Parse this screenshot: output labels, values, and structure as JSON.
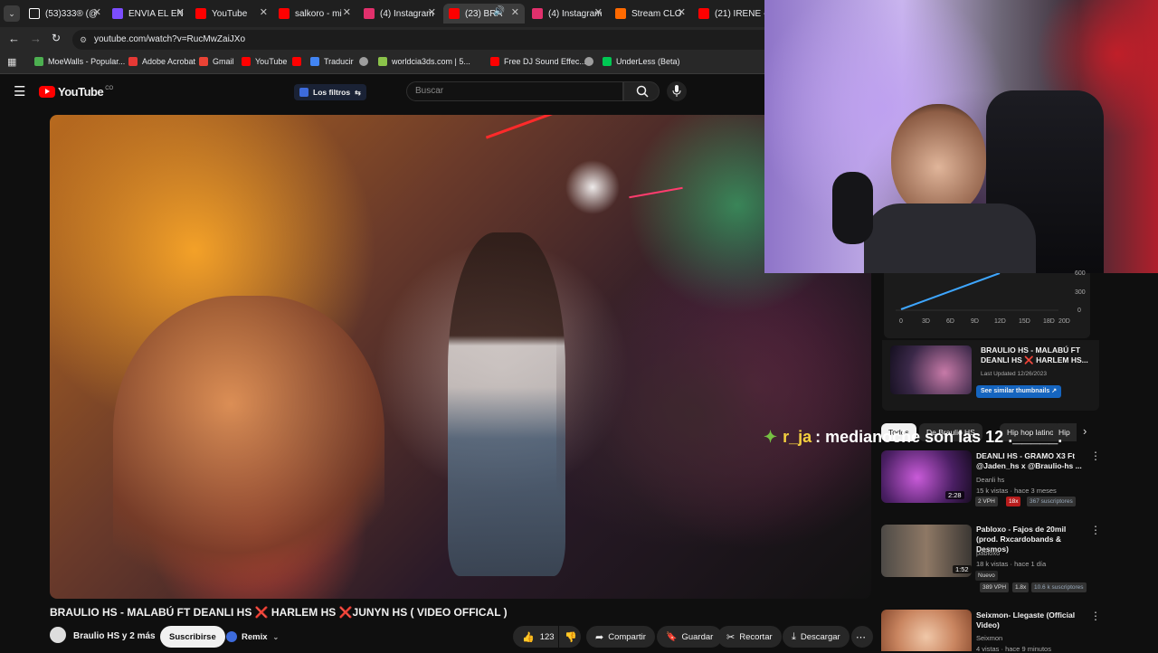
{
  "browser": {
    "tabs": [
      {
        "title": "(53)333® (@",
        "color": "#ffffff"
      },
      {
        "title": "ENVIA EL EN",
        "color": "#7c4dff"
      },
      {
        "title": "YouTube",
        "color": "#ff0000"
      },
      {
        "title": "salkoro - mi",
        "color": "#ff0000"
      },
      {
        "title": "(4) Instagram",
        "color": "#e1306c"
      },
      {
        "title": "(23) BRA",
        "color": "#ff0000"
      },
      {
        "title": "(4) Instagram",
        "color": "#e1306c"
      },
      {
        "title": "Stream CLO",
        "color": "#ff6a00"
      },
      {
        "title": "(21) IRENE -",
        "color": "#ff0000"
      }
    ],
    "tab_close": "✕",
    "url": "youtube.com/watch?v=RucMwZaiJXo",
    "bookmarks": [
      {
        "label": "MoeWalls - Popular...",
        "color": "#4caf50"
      },
      {
        "label": "Adobe Acrobat",
        "color": "#e53935"
      },
      {
        "label": "Gmail",
        "color": "#ea4335"
      },
      {
        "label": "YouTube",
        "color": "#ff0000"
      },
      {
        "label": "",
        "color": "#ff0000"
      },
      {
        "label": "Traducir",
        "color": "#4285f4"
      },
      {
        "label": "",
        "color": "#9e9e9e"
      },
      {
        "label": "worldcia3ds.com | 5...",
        "color": "#8bc34a"
      },
      {
        "label": "Free DJ Sound Effec...",
        "color": "#ff0000"
      },
      {
        "label": "",
        "color": "#9e9e9e"
      },
      {
        "label": "UnderLess (Beta)",
        "color": "#00c853"
      }
    ]
  },
  "youtube": {
    "logo": "YouTube",
    "country": "CO",
    "filters_label": "Los filtros",
    "search_placeholder": "Buscar",
    "video_title": "BRAULIO HS - MALABÚ FT DEANLI HS ❌ HARLEM HS ❌JUNYN HS ( VIDEO OFFICAL )",
    "channel": "Braulio HS y 2 más",
    "subscribe": "Suscribirse",
    "remix": "Remix",
    "likes": "123",
    "share": "Compartir",
    "save": "Guardar",
    "clip": "Recortar",
    "download": "Descargar"
  },
  "stats_widget": {
    "y_ticks": [
      "600",
      "300",
      "0"
    ],
    "x_ticks": [
      "0",
      "3D",
      "6D",
      "9D",
      "12D",
      "15D",
      "18D",
      "20D"
    ],
    "video_title": "BRAULIO HS - MALABÚ FT DEANLI HS ❌ HARLEM HS...",
    "updated": "Last Updated 12/26/2023",
    "button": "See similar thumbnails ↗"
  },
  "chips": [
    "Todos",
    "De Braulio HS",
    "Hip hop latino",
    "Hip"
  ],
  "chat": {
    "user": "r_ja",
    "message": ": medianoche son las 12 ._____."
  },
  "recommended": [
    {
      "title": "DEANLI HS - GRAMO X3 Ft @Jaden_hs x @Braulio-hs ...",
      "channel": "Deanli hs",
      "meta": "15 k vistas · hace 3 meses",
      "duration": "2:28",
      "badges": [
        "2 VPH",
        "18x",
        "367 suscriptores"
      ]
    },
    {
      "title": "Pabloxo - Fajos de 20mil (prod. Rxcardobands & Desmos)",
      "channel": "pabloxo",
      "meta": "18 k vistas · hace 1 día",
      "duration": "1:52",
      "tag": "Nuevo",
      "badges": [
        "389 VPH",
        "1.8x",
        "10.6 k suscriptores"
      ]
    },
    {
      "title": "Seixmon- Llegaste  (Official Video)",
      "channel": "Seixmon",
      "meta": "4 vistas · hace 9 minutos"
    }
  ]
}
